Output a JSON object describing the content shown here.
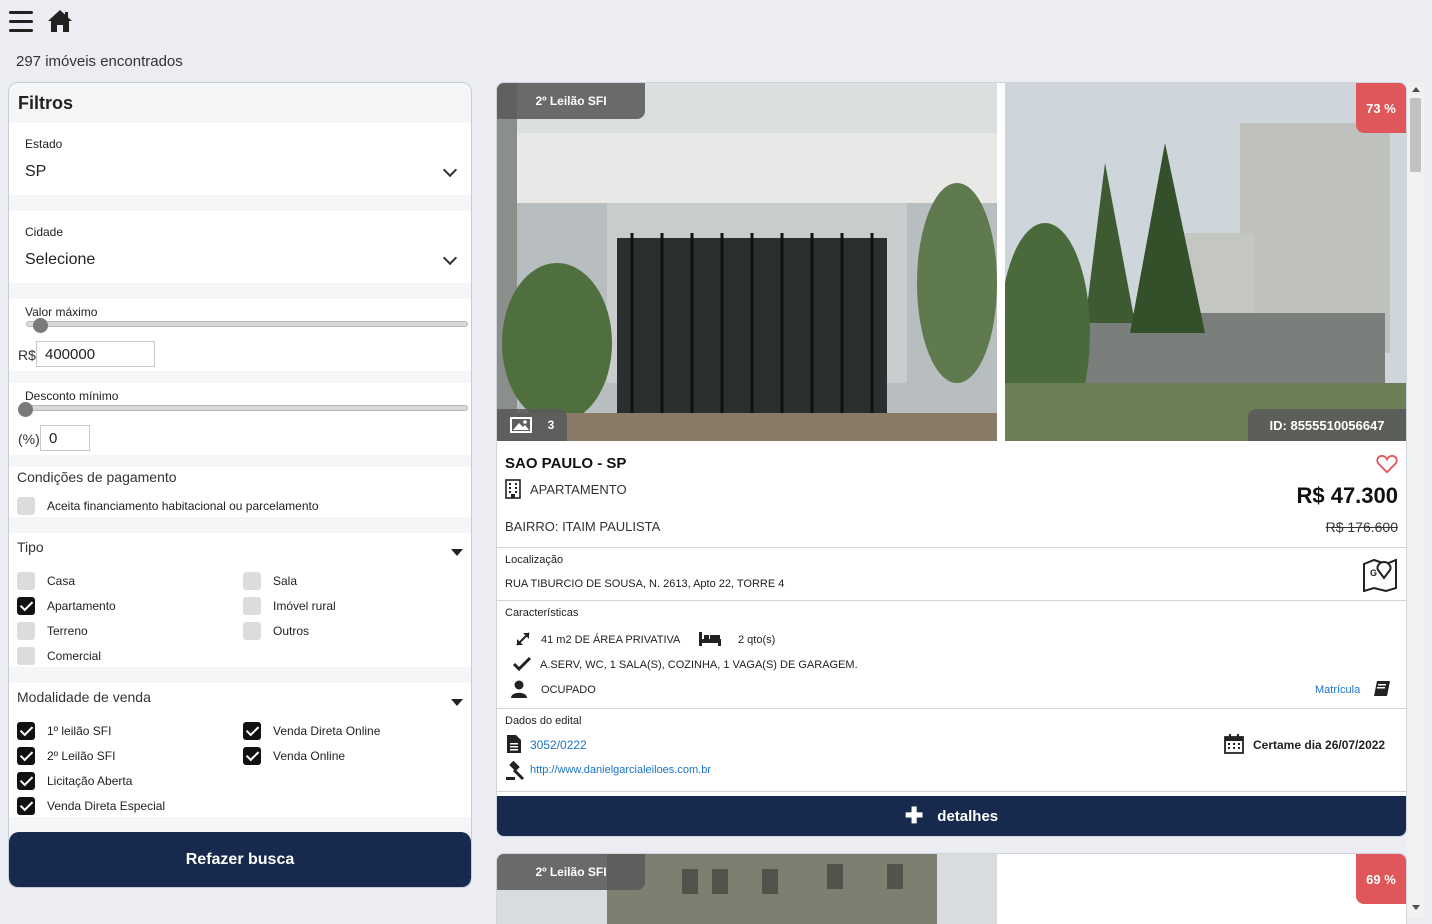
{
  "header": {
    "results_count": "297 imóveis encontrados"
  },
  "filters": {
    "title": "Filtros",
    "estado": {
      "label": "Estado",
      "value": "SP"
    },
    "cidade": {
      "label": "Cidade",
      "value": "Selecione"
    },
    "valor_maximo": {
      "label": "Valor máximo",
      "prefix": "R$",
      "value": "400000"
    },
    "desconto_minimo": {
      "label": "Desconto mínimo",
      "prefix": "(%)",
      "value": "0"
    },
    "pagamento": {
      "title": "Condições de pagamento",
      "option": "Aceita financiamento habitacional ou parcelamento",
      "checked": false
    },
    "tipo": {
      "title": "Tipo",
      "options": [
        {
          "label": "Casa",
          "checked": false
        },
        {
          "label": "Sala",
          "checked": false
        },
        {
          "label": "Apartamento",
          "checked": true
        },
        {
          "label": "Imóvel rural",
          "checked": false
        },
        {
          "label": "Terreno",
          "checked": false
        },
        {
          "label": "Outros",
          "checked": false
        },
        {
          "label": "Comercial",
          "checked": false
        }
      ]
    },
    "modalidade": {
      "title": "Modalidade de venda",
      "options": [
        {
          "label": "1º leilão SFI",
          "checked": true
        },
        {
          "label": "Venda Direta Online",
          "checked": true
        },
        {
          "label": "2º Leilão SFI",
          "checked": true
        },
        {
          "label": "Venda Online",
          "checked": true
        },
        {
          "label": "Licitação Aberta",
          "checked": true
        },
        {
          "label": "Venda Direta Especial",
          "checked": true
        }
      ]
    },
    "submit_label": "Refazer busca"
  },
  "listing": {
    "auction_badge": "2º Leilão SFI",
    "discount_badge": "73 %",
    "photo_count": "3",
    "id_label": "ID: 8555510056647",
    "city": "SAO PAULO - SP",
    "property_type": "APARTAMENTO",
    "price": "R$ 47.300",
    "bairro": "BAIRRO: ITAIM PAULISTA",
    "old_price": "R$ 176.600",
    "localizacao_label": "Localização",
    "address": "RUA TIBURCIO DE SOUSA, N. 2613, Apto 22, TORRE 4",
    "caracteristicas_label": "Características",
    "area": "41 m2 DE ÁREA PRIVATIVA",
    "quartos": "2 qto(s)",
    "extras": "A.SERV, WC, 1 SALA(S), COZINHA, 1 VAGA(S) DE GARAGEM.",
    "ocupacao": "OCUPADO",
    "matricula_label": "Matrícula",
    "edital_label": "Dados do edital",
    "edital_number": "3052/0222",
    "certame": "Certame dia 26/07/2022",
    "leiloeiro_url": "http://www.danielgarcialeiloes.com.br",
    "details_label": "detalhes"
  },
  "listing2": {
    "auction_badge": "2º Leilão SFI",
    "discount_badge": "69 %"
  },
  "colors": {
    "navy": "#172a4e",
    "discount_red": "#e0575b",
    "link_blue": "#1a73c9"
  }
}
